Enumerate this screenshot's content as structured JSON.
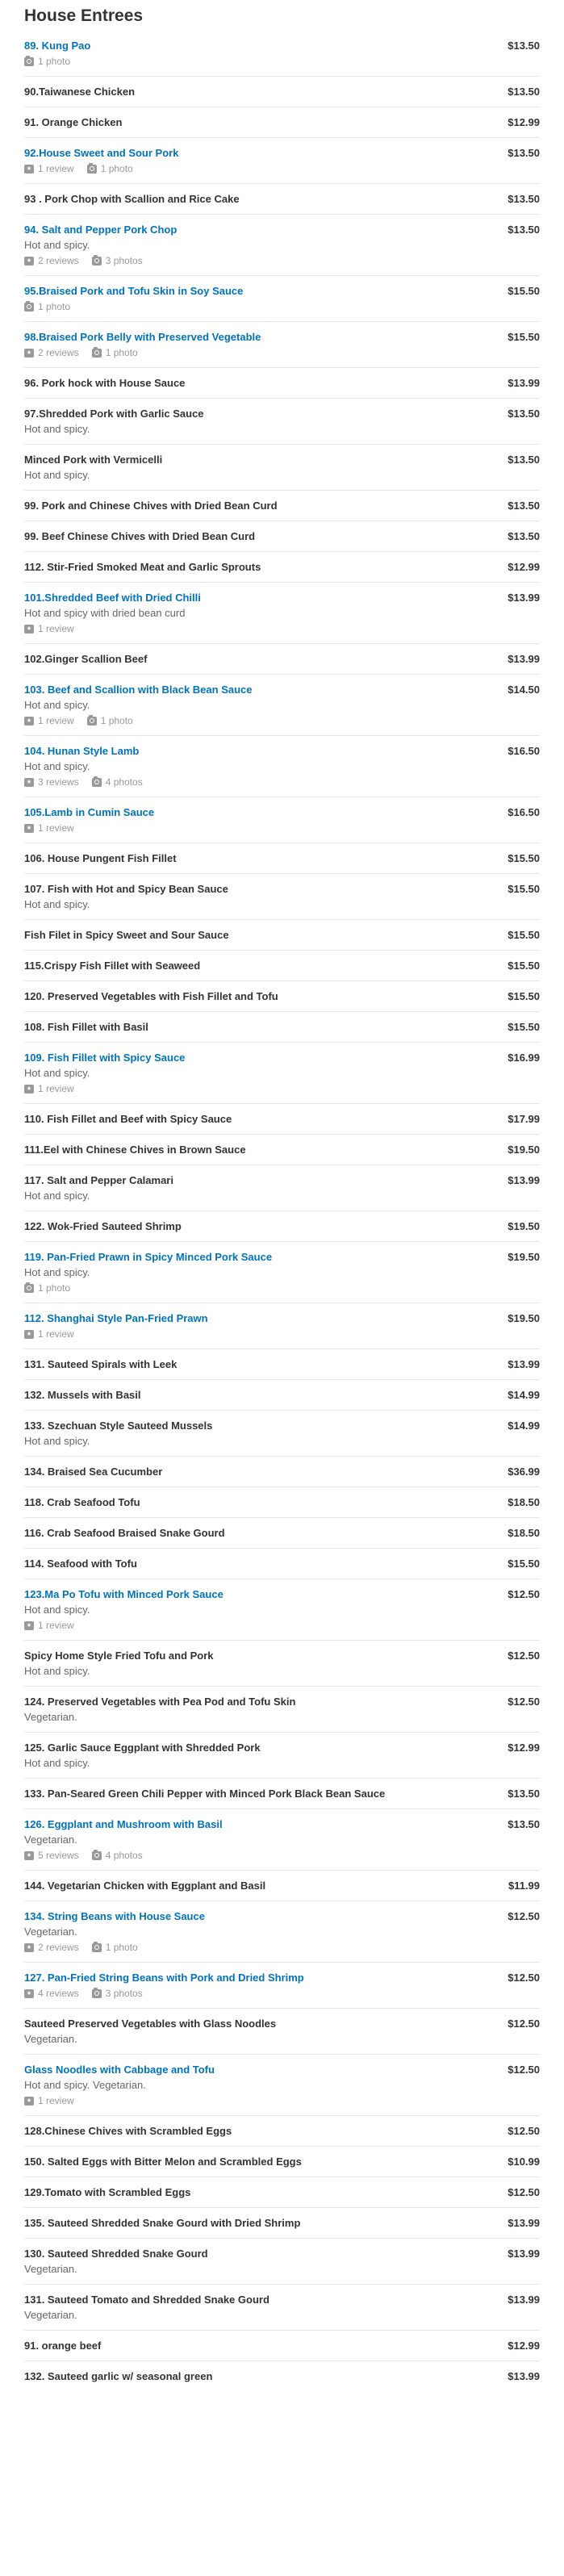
{
  "section_title": "House Entrees",
  "items": [
    {
      "name": "89. Kung Pao",
      "price": "$13.50",
      "link": true,
      "desc": "",
      "reviews": "",
      "photos": "1 photo"
    },
    {
      "name": "90.Taiwanese Chicken",
      "price": "$13.50",
      "link": false,
      "desc": "",
      "reviews": "",
      "photos": ""
    },
    {
      "name": "91. Orange Chicken",
      "price": "$12.99",
      "link": false,
      "desc": "",
      "reviews": "",
      "photos": ""
    },
    {
      "name": "92.House Sweet and Sour Pork",
      "price": "$13.50",
      "link": true,
      "desc": "",
      "reviews": "1 review",
      "photos": "1 photo"
    },
    {
      "name": "93 . Pork Chop with Scallion and Rice Cake",
      "price": "$13.50",
      "link": false,
      "desc": "",
      "reviews": "",
      "photos": ""
    },
    {
      "name": "94. Salt and Pepper Pork Chop",
      "price": "$13.50",
      "link": true,
      "desc": "Hot and spicy.",
      "reviews": "2 reviews",
      "photos": "3 photos"
    },
    {
      "name": "95.Braised Pork and Tofu Skin in Soy Sauce",
      "price": "$15.50",
      "link": true,
      "desc": "",
      "reviews": "",
      "photos": "1 photo"
    },
    {
      "name": "98.Braised Pork Belly with Preserved Vegetable",
      "price": "$15.50",
      "link": true,
      "desc": "",
      "reviews": "2 reviews",
      "photos": "1 photo"
    },
    {
      "name": "96. Pork hock with House Sauce",
      "price": "$13.99",
      "link": false,
      "desc": "",
      "reviews": "",
      "photos": ""
    },
    {
      "name": "97.Shredded Pork with Garlic Sauce",
      "price": "$13.50",
      "link": false,
      "desc": "Hot and spicy.",
      "reviews": "",
      "photos": ""
    },
    {
      "name": "Minced Pork with Vermicelli",
      "price": "$13.50",
      "link": false,
      "desc": "Hot and spicy.",
      "reviews": "",
      "photos": ""
    },
    {
      "name": "99. Pork and Chinese Chives with Dried Bean Curd",
      "price": "$13.50",
      "link": false,
      "desc": "",
      "reviews": "",
      "photos": ""
    },
    {
      "name": "99. Beef Chinese Chives with Dried Bean Curd",
      "price": "$13.50",
      "link": false,
      "desc": "",
      "reviews": "",
      "photos": ""
    },
    {
      "name": "112. Stir-Fried Smoked Meat and Garlic Sprouts",
      "price": "$12.99",
      "link": false,
      "desc": "",
      "reviews": "",
      "photos": ""
    },
    {
      "name": "101.Shredded Beef with Dried Chilli",
      "price": "$13.99",
      "link": true,
      "desc": "Hot and spicy with dried bean curd",
      "reviews": "1 review",
      "photos": ""
    },
    {
      "name": "102.Ginger Scallion Beef",
      "price": "$13.99",
      "link": false,
      "desc": "",
      "reviews": "",
      "photos": ""
    },
    {
      "name": "103. Beef and Scallion with Black Bean Sauce",
      "price": "$14.50",
      "link": true,
      "desc": "Hot and spicy.",
      "reviews": "1 review",
      "photos": "1 photo"
    },
    {
      "name": "104. Hunan Style Lamb",
      "price": "$16.50",
      "link": true,
      "desc": "Hot and spicy.",
      "reviews": "3 reviews",
      "photos": "4 photos"
    },
    {
      "name": "105.Lamb in Cumin Sauce",
      "price": "$16.50",
      "link": true,
      "desc": "",
      "reviews": "1 review",
      "photos": ""
    },
    {
      "name": "106. House Pungent Fish Fillet",
      "price": "$15.50",
      "link": false,
      "desc": "",
      "reviews": "",
      "photos": ""
    },
    {
      "name": "107. Fish with Hot and Spicy Bean Sauce",
      "price": "$15.50",
      "link": false,
      "desc": "Hot and spicy.",
      "reviews": "",
      "photos": ""
    },
    {
      "name": "Fish Filet in Spicy Sweet and Sour Sauce",
      "price": "$15.50",
      "link": false,
      "desc": "",
      "reviews": "",
      "photos": ""
    },
    {
      "name": "115.Crispy Fish Fillet with Seaweed",
      "price": "$15.50",
      "link": false,
      "desc": "",
      "reviews": "",
      "photos": ""
    },
    {
      "name": "120. Preserved Vegetables with Fish Fillet and Tofu",
      "price": "$15.50",
      "link": false,
      "desc": "",
      "reviews": "",
      "photos": ""
    },
    {
      "name": "108. Fish Fillet with Basil",
      "price": "$15.50",
      "link": false,
      "desc": "",
      "reviews": "",
      "photos": ""
    },
    {
      "name": "109. Fish Fillet with Spicy Sauce",
      "price": "$16.99",
      "link": true,
      "desc": "Hot and spicy.",
      "reviews": "1 review",
      "photos": ""
    },
    {
      "name": "110. Fish Fillet and Beef with Spicy Sauce",
      "price": "$17.99",
      "link": false,
      "desc": "",
      "reviews": "",
      "photos": ""
    },
    {
      "name": "111.Eel with Chinese Chives in Brown Sauce",
      "price": "$19.50",
      "link": false,
      "desc": "",
      "reviews": "",
      "photos": ""
    },
    {
      "name": "117. Salt and Pepper Calamari",
      "price": "$13.99",
      "link": false,
      "desc": "Hot and spicy.",
      "reviews": "",
      "photos": ""
    },
    {
      "name": "122. Wok-Fried Sauteed Shrimp",
      "price": "$19.50",
      "link": false,
      "desc": "",
      "reviews": "",
      "photos": ""
    },
    {
      "name": "119. Pan-Fried Prawn in Spicy Minced Pork Sauce",
      "price": "$19.50",
      "link": true,
      "desc": "Hot and spicy.",
      "reviews": "",
      "photos": "1 photo"
    },
    {
      "name": "112. Shanghai Style Pan-Fried Prawn",
      "price": "$19.50",
      "link": true,
      "desc": "",
      "reviews": "1 review",
      "photos": ""
    },
    {
      "name": "131. Sauteed Spirals with Leek",
      "price": "$13.99",
      "link": false,
      "desc": "",
      "reviews": "",
      "photos": ""
    },
    {
      "name": "132. Mussels with Basil",
      "price": "$14.99",
      "link": false,
      "desc": "",
      "reviews": "",
      "photos": ""
    },
    {
      "name": "133. Szechuan Style Sauteed Mussels",
      "price": "$14.99",
      "link": false,
      "desc": "Hot and spicy.",
      "reviews": "",
      "photos": ""
    },
    {
      "name": "134. Braised Sea Cucumber",
      "price": "$36.99",
      "link": false,
      "desc": "",
      "reviews": "",
      "photos": ""
    },
    {
      "name": "118. Crab Seafood Tofu",
      "price": "$18.50",
      "link": false,
      "desc": "",
      "reviews": "",
      "photos": ""
    },
    {
      "name": "116. Crab Seafood Braised Snake Gourd",
      "price": "$18.50",
      "link": false,
      "desc": "",
      "reviews": "",
      "photos": ""
    },
    {
      "name": "114. Seafood with Tofu",
      "price": "$15.50",
      "link": false,
      "desc": "",
      "reviews": "",
      "photos": ""
    },
    {
      "name": "123.Ma Po Tofu with Minced Pork Sauce",
      "price": "$12.50",
      "link": true,
      "desc": "Hot and spicy.",
      "reviews": "1 review",
      "photos": ""
    },
    {
      "name": "Spicy Home Style Fried Tofu and Pork",
      "price": "$12.50",
      "link": false,
      "desc": "Hot and spicy.",
      "reviews": "",
      "photos": ""
    },
    {
      "name": "124. Preserved Vegetables with Pea Pod and Tofu Skin",
      "price": "$12.50",
      "link": false,
      "desc": "Vegetarian.",
      "reviews": "",
      "photos": ""
    },
    {
      "name": "125. Garlic Sauce Eggplant with Shredded Pork",
      "price": "$12.99",
      "link": false,
      "desc": "Hot and spicy.",
      "reviews": "",
      "photos": ""
    },
    {
      "name": "133. Pan-Seared Green Chili Pepper with Minced Pork Black Bean Sauce",
      "price": "$13.50",
      "link": false,
      "desc": "",
      "reviews": "",
      "photos": ""
    },
    {
      "name": "126. Eggplant and Mushroom with Basil",
      "price": "$13.50",
      "link": true,
      "desc": "Vegetarian.",
      "reviews": "5 reviews",
      "photos": "4 photos"
    },
    {
      "name": "144. Vegetarian Chicken with Eggplant and Basil",
      "price": "$11.99",
      "link": false,
      "desc": "",
      "reviews": "",
      "photos": ""
    },
    {
      "name": "134. String Beans with House Sauce",
      "price": "$12.50",
      "link": true,
      "desc": "Vegetarian.",
      "reviews": "2 reviews",
      "photos": "1 photo"
    },
    {
      "name": "127. Pan-Fried String Beans with Pork and Dried Shrimp",
      "price": "$12.50",
      "link": true,
      "desc": "",
      "reviews": "4 reviews",
      "photos": "3 photos"
    },
    {
      "name": "Sauteed Preserved Vegetables with Glass Noodles",
      "price": "$12.50",
      "link": false,
      "desc": "Vegetarian.",
      "reviews": "",
      "photos": ""
    },
    {
      "name": "Glass Noodles with Cabbage and Tofu",
      "price": "$12.50",
      "link": true,
      "desc": "Hot and spicy. Vegetarian.",
      "reviews": "1 review",
      "photos": ""
    },
    {
      "name": "128.Chinese Chives with Scrambled Eggs",
      "price": "$12.50",
      "link": false,
      "desc": "",
      "reviews": "",
      "photos": ""
    },
    {
      "name": "150. Salted Eggs with Bitter Melon and Scrambled Eggs",
      "price": "$10.99",
      "link": false,
      "desc": "",
      "reviews": "",
      "photos": ""
    },
    {
      "name": "129.Tomato with Scrambled Eggs",
      "price": "$12.50",
      "link": false,
      "desc": "",
      "reviews": "",
      "photos": ""
    },
    {
      "name": "135. Sauteed Shredded Snake Gourd with Dried Shrimp",
      "price": "$13.99",
      "link": false,
      "desc": "",
      "reviews": "",
      "photos": ""
    },
    {
      "name": "130. Sauteed Shredded Snake Gourd",
      "price": "$13.99",
      "link": false,
      "desc": "Vegetarian.",
      "reviews": "",
      "photos": ""
    },
    {
      "name": "131. Sauteed Tomato and Shredded Snake Gourd",
      "price": "$13.99",
      "link": false,
      "desc": "Vegetarian.",
      "reviews": "",
      "photos": ""
    },
    {
      "name": "91. orange beef",
      "price": "$12.99",
      "link": false,
      "desc": "",
      "reviews": "",
      "photos": ""
    },
    {
      "name": "132. Sauteed garlic w/ seasonal green",
      "price": "$13.99",
      "link": false,
      "desc": "",
      "reviews": "",
      "photos": ""
    }
  ]
}
